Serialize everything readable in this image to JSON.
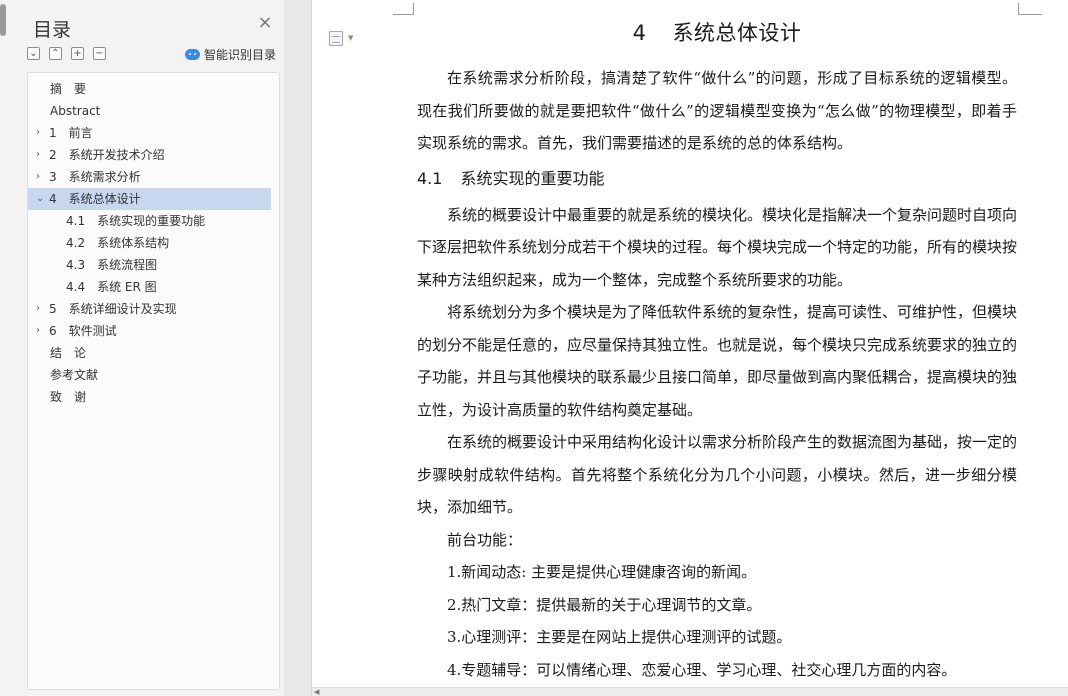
{
  "toc": {
    "title": "目录",
    "close": "×",
    "tools": [
      "⌄",
      "⌃",
      "+",
      "−"
    ],
    "smart_label": "智能识别目录",
    "items": [
      {
        "label": "摘　要",
        "level": 0,
        "chevron": ""
      },
      {
        "label": "Abstract",
        "level": 0,
        "chevron": ""
      },
      {
        "label": "1　前言",
        "level": 1,
        "chevron": "›"
      },
      {
        "label": "2　系统开发技术介绍",
        "level": 1,
        "chevron": "›"
      },
      {
        "label": "3　系统需求分析",
        "level": 1,
        "chevron": "›"
      },
      {
        "label": "4　系统总体设计",
        "level": 1,
        "chevron": "⌄",
        "active": true
      },
      {
        "label": "4.1　系统实现的重要功能",
        "level": 2,
        "chevron": ""
      },
      {
        "label": "4.2　系统体系结构",
        "level": 2,
        "chevron": ""
      },
      {
        "label": "4.3　系统流程图",
        "level": 2,
        "chevron": ""
      },
      {
        "label": "4.4　系统 ER 图",
        "level": 2,
        "chevron": ""
      },
      {
        "label": "5　系统详细设计及实现",
        "level": 1,
        "chevron": "›"
      },
      {
        "label": "6　软件测试",
        "level": 1,
        "chevron": "›"
      },
      {
        "label": "结　论",
        "level": 0,
        "chevron": ""
      },
      {
        "label": "参考文献",
        "level": 0,
        "chevron": ""
      },
      {
        "label": "致　谢",
        "level": 0,
        "chevron": ""
      }
    ]
  },
  "document": {
    "chapter_num": "4",
    "chapter_title": "系统总体设计",
    "intro": "在系统需求分析阶段，搞清楚了软件“做什么”的问题，形成了目标系统的逻辑模型。现在我们所要做的就是要把软件“做什么”的逻辑模型变换为“怎么做”的物理模型，即着手实现系统的需求。首先，我们需要描述的是系统的总的体系结构。",
    "section_num": "4.1",
    "section_title": "系统实现的重要功能",
    "para2": "系统的概要设计中最重要的就是系统的模块化。模块化是指解决一个复杂问题时自项向下逐层把软件系统划分成若干个模块的过程。每个模块完成一个特定的功能，所有的模块按某种方法组织起来，成为一个整体，完成整个系统所要求的功能。",
    "para3": "将系统划分为多个模块是为了降低软件系统的复杂性，提高可读性、可维护性，但模块的划分不能是任意的，应尽量保持其独立性。也就是说，每个模块只完成系统要求的独立的子功能，并且与其他模块的联系最少且接口简单，即尽量做到高内聚低耦合，提高模块的独立性，为设计高质量的软件结构奠定基础。",
    "para4": "在系统的概要设计中采用结构化设计以需求分析阶段产生的数据流图为基础，按一定的步骤映射成软件结构。首先将整个系统化分为几个小问题，小模块。然后，进一步细分模块，添加细节。",
    "list_heading": "前台功能：",
    "list": [
      "1.新闻动态: 主要是提供心理健康咨询的新闻。",
      "2.热门文章：提供最新的关于心理调节的文章。",
      "3.心理测评：主要是在网站上提供心理测评的试题。",
      "4.专题辅导：可以情绪心理、恋爱心理、学习心理、社交心理几方面的内容。"
    ]
  }
}
